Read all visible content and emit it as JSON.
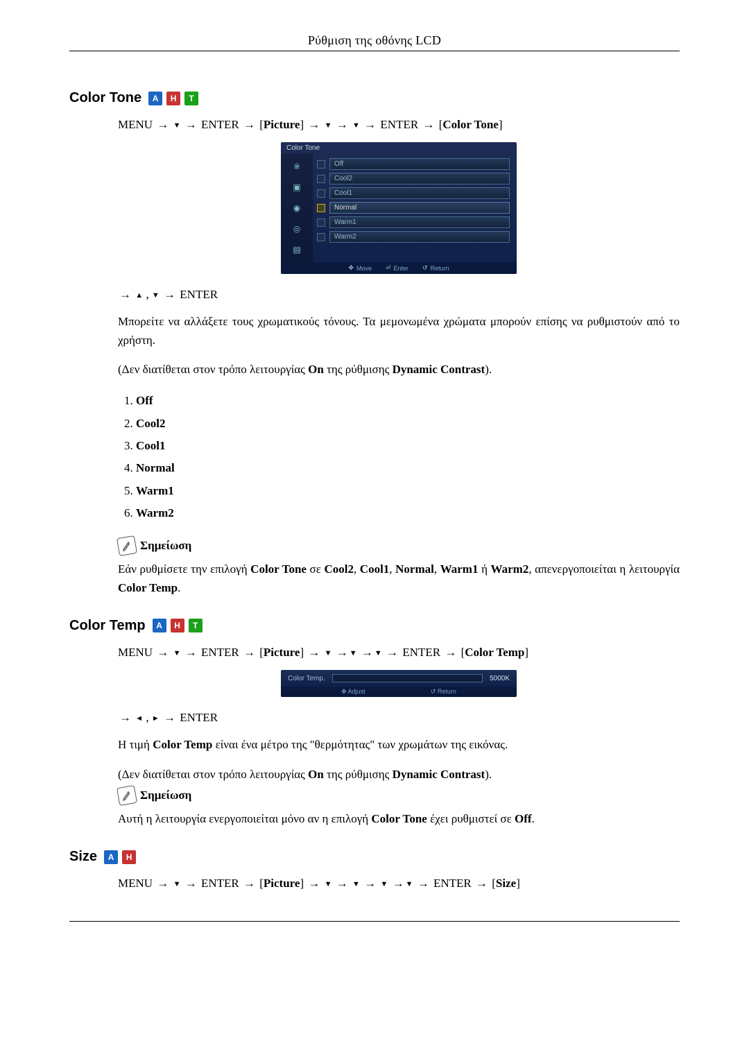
{
  "page": {
    "header": "Ρύθμιση της οθόνης LCD"
  },
  "badges": {
    "a": "A",
    "h": "H",
    "t": "T"
  },
  "sym": {
    "arr": "→",
    "up": "▲",
    "down": "▼",
    "left": "◄",
    "right": "►",
    "comma": ", "
  },
  "s1": {
    "title": "Color Tone",
    "path": {
      "pre": "MENU ",
      "enter1": " ENTER ",
      "pic": "Picture",
      "enter2": " ENTER ",
      "dest": "Color Tone"
    },
    "osd": {
      "title": "Color Tone",
      "items": [
        "Off",
        "Cool2",
        "Cool1",
        "Normal",
        "Warm1",
        "Warm2"
      ],
      "sel_index": 3,
      "btm_move": "Move",
      "btm_enter": "Enter",
      "btm_return": "Return"
    },
    "nav_tail": " ENTER",
    "p1": "Μπορείτε να αλλάξετε τους χρωματικούς τόνους. Τα μεμονωμένα χρώματα μπορούν επίσης να ρυθμιστούν από το χρήστη.",
    "p2_a": "(Δεν διατίθεται στον τρόπο λειτουργίας ",
    "p2_on": "On",
    "p2_b": " της ρύθμισης ",
    "p2_dc": "Dynamic Contrast",
    "p2_c": ").",
    "list": [
      "Off",
      "Cool2",
      "Cool1",
      "Normal",
      "Warm1",
      "Warm2"
    ],
    "note_label": "Σημείωση",
    "note_a": "Εάν ρυθμίσετε την επιλογή ",
    "note_b": "Color Tone",
    "note_c": " σε ",
    "note_d": "Cool2",
    "note_e": ", ",
    "note_f": "Cool1",
    "note_g": ", ",
    "note_h": "Normal",
    "note_i": ", ",
    "note_j": "Warm1",
    "note_k": " ή ",
    "note_l": "Warm2",
    "note_m": ", απενεργοποιείται η λειτουργία ",
    "note_n": "Color Temp",
    "note_o": "."
  },
  "s2": {
    "title": "Color Temp",
    "path": {
      "pre": "MENU ",
      "enter1": " ENTER ",
      "pic": "Picture",
      "enter2": " ENTER ",
      "dest": "Color Temp"
    },
    "osd": {
      "title": "Color Temp.",
      "val": "5000K",
      "btm_adjust": "Adjust",
      "btm_return": "Return"
    },
    "nav_tail": " ENTER",
    "p1_a": "Η τιμή ",
    "p1_b": "Color Temp",
    "p1_c": " είναι ένα μέτρο της \"θερμότητας\" των χρωμάτων της εικόνας.",
    "p2_a": "(Δεν διατίθεται στον τρόπο λειτουργίας ",
    "p2_on": "On",
    "p2_b": " της ρύθμισης ",
    "p2_dc": "Dynamic Contrast",
    "p2_c": ").",
    "note_label": "Σημείωση",
    "note_a": "Αυτή η λειτουργία ενεργοποιείται μόνο αν η επιλογή ",
    "note_b": "Color Tone",
    "note_c": " έχει ρυθμιστεί σε ",
    "note_d": "Off",
    "note_e": "."
  },
  "s3": {
    "title": "Size",
    "path": {
      "pre": "MENU ",
      "enter1": " ENTER ",
      "pic": "Picture",
      "enter2": " ENTER ",
      "dest": "Size"
    }
  }
}
